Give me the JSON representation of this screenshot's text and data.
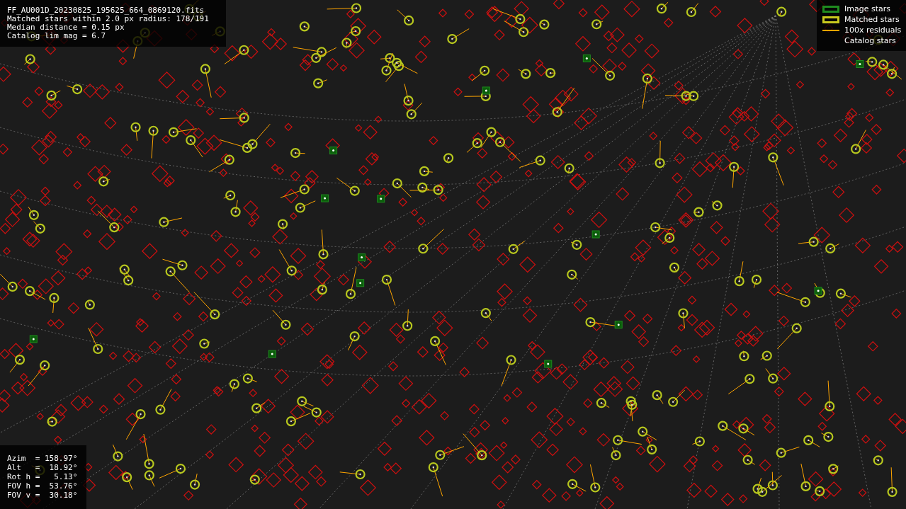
{
  "info_lines": [
    "FF_AU001D_20230825_195625_664_0869120.fits",
    "Matched stars within 2.0 px radius: 178/191",
    "Median distance = 0.15 px",
    "Catalog lim mag = 6.7"
  ],
  "legend": [
    {
      "label": "Image stars",
      "kind": "box",
      "color": "#1f8a1f"
    },
    {
      "label": "Matched stars",
      "kind": "box",
      "color": "#c8c81e"
    },
    {
      "label": "100x residuals",
      "kind": "line",
      "color": "#ffa500"
    },
    {
      "label": "Catalog stars",
      "kind": "none"
    }
  ],
  "pointing_lines": [
    "Azim  = 158.97°",
    "Alt   =  18.92°",
    "Rot h =   5.13°",
    "FOV h =  53.76°",
    "FOV v =  30.18°"
  ]
}
